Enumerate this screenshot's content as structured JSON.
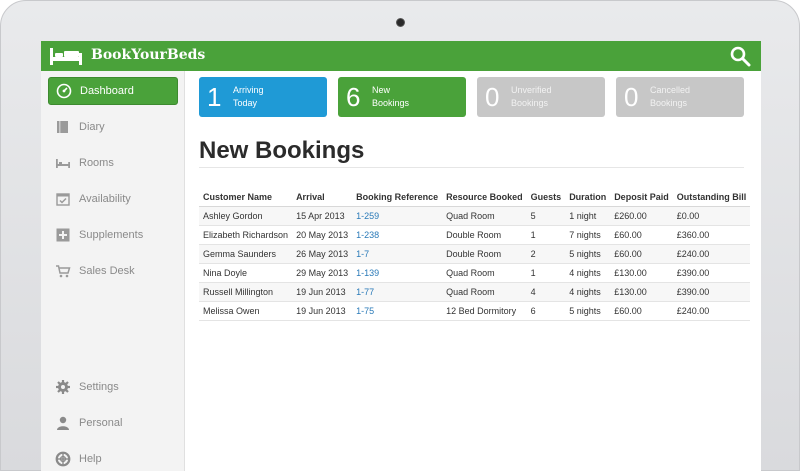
{
  "app": {
    "brand": "BookYourBeds"
  },
  "sidebar": {
    "items": [
      {
        "label": "Dashboard",
        "icon": "dashboard-gauge-icon"
      },
      {
        "label": "Diary",
        "icon": "diary-book-icon"
      },
      {
        "label": "Rooms",
        "icon": "bed-icon"
      },
      {
        "label": "Availability",
        "icon": "calendar-check-icon"
      },
      {
        "label": "Supplements",
        "icon": "plus-box-icon"
      },
      {
        "label": "Sales Desk",
        "icon": "cart-icon"
      },
      {
        "label": "Settings",
        "icon": "gear-icon"
      },
      {
        "label": "Personal",
        "icon": "user-icon"
      },
      {
        "label": "Help",
        "icon": "lifebuoy-icon"
      }
    ]
  },
  "tiles": [
    {
      "count": "1",
      "label": "Arriving\nToday",
      "color": "#1f9ad6"
    },
    {
      "count": "6",
      "label": "New\nBookings",
      "color": "#4aa23a"
    },
    {
      "count": "0",
      "label": "Unverified\nBookings",
      "color": "#c7c7c7"
    },
    {
      "count": "0",
      "label": "Cancelled\nBookings",
      "color": "#c7c7c7"
    }
  ],
  "main": {
    "title": "New Bookings"
  },
  "table": {
    "headers": [
      "Customer Name",
      "Arrival",
      "Booking Reference",
      "Resource Booked",
      "Guests",
      "Duration",
      "Deposit Paid",
      "Outstanding Bill"
    ],
    "rows": [
      [
        "Ashley Gordon",
        "15 Apr 2013",
        "1-259",
        "Quad Room",
        "5",
        "1 night",
        "£260.00",
        "£0.00"
      ],
      [
        "Elizabeth Richardson",
        "20 May 2013",
        "1-238",
        "Double Room",
        "1",
        "7 nights",
        "£60.00",
        "£360.00"
      ],
      [
        "Gemma Saunders",
        "26 May 2013",
        "1-7",
        "Double Room",
        "2",
        "5 nights",
        "£60.00",
        "£240.00"
      ],
      [
        "Nina Doyle",
        "29 May 2013",
        "1-139",
        "Quad Room",
        "1",
        "4 nights",
        "£130.00",
        "£390.00"
      ],
      [
        "Russell Millington",
        "19 Jun 2013",
        "1-77",
        "Quad Room",
        "4",
        "4 nights",
        "£130.00",
        "£390.00"
      ],
      [
        "Melissa Owen",
        "19 Jun 2013",
        "1-75",
        "12 Bed Dormitory",
        "6",
        "5 nights",
        "£60.00",
        "£240.00"
      ]
    ]
  },
  "colors": {
    "brand_green": "#4aa23a",
    "info_blue": "#1f9ad6",
    "muted_grey": "#c7c7c7",
    "link_blue": "#2a7ab8"
  }
}
